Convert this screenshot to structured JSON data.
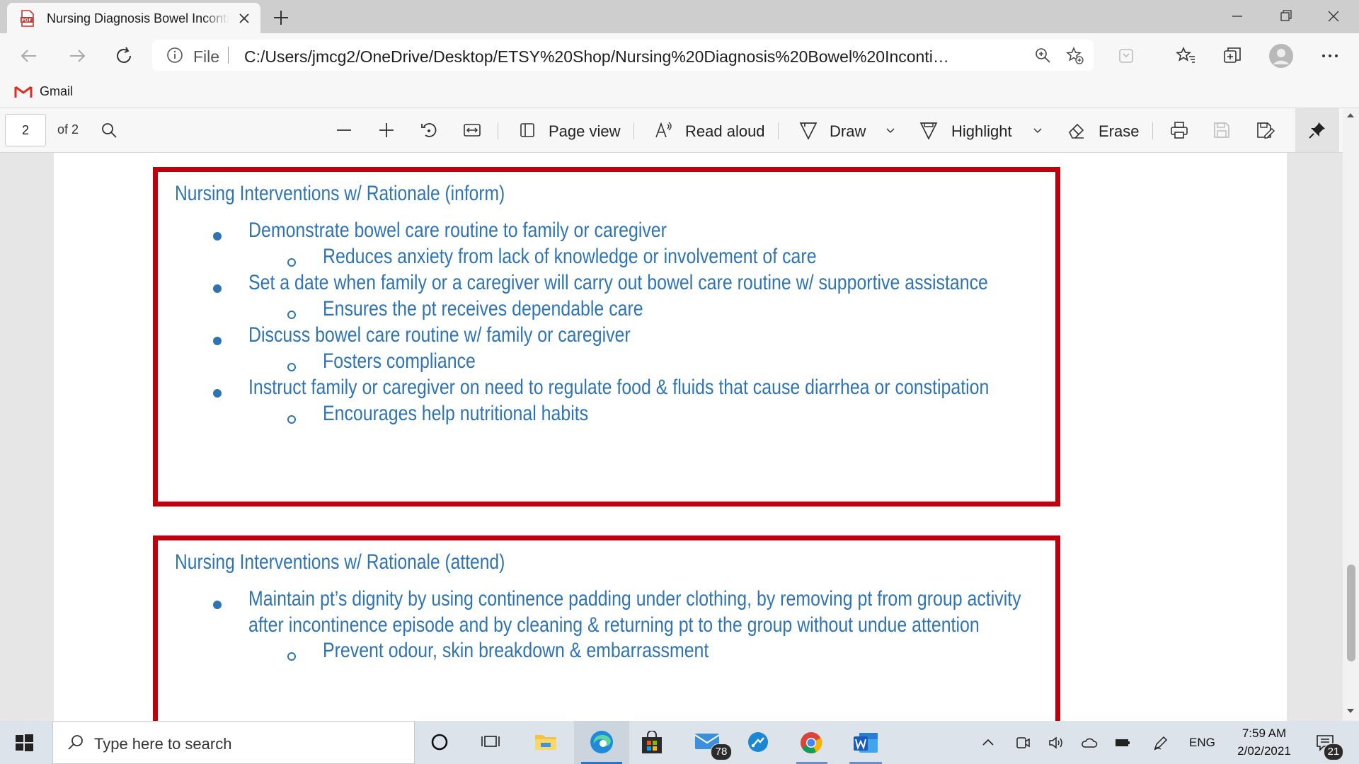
{
  "tab": {
    "title": "Nursing Diagnosis Bowel Incontinence"
  },
  "address": {
    "scheme_label": "File",
    "url": "C:/Users/jmcg2/OneDrive/Desktop/ETSY%20Shop/Nursing%20Diagnosis%20Bowel%20Incontinence..."
  },
  "bookmarks": [
    {
      "label": "Gmail"
    }
  ],
  "pdf_toolbar": {
    "page_number": "2",
    "page_count": "of 2",
    "page_view_label": "Page view",
    "read_aloud_label": "Read aloud",
    "draw_label": "Draw",
    "highlight_label": "Highlight",
    "erase_label": "Erase"
  },
  "document": {
    "sections": [
      {
        "title": "Nursing Interventions w/ Rationale (inform)",
        "items": [
          {
            "text": "Demonstrate bowel care routine to family or caregiver",
            "rationale": "Reduces anxiety from lack of knowledge or involvement of care"
          },
          {
            "text": "Set a date when family or a caregiver will carry out bowel care routine w/ supportive assistance",
            "rationale": "Ensures the pt receives dependable care"
          },
          {
            "text": "Discuss bowel care routine w/ family or caregiver",
            "rationale": "Fosters compliance"
          },
          {
            "text": "Instruct family or caregiver on need to regulate food & fluids that cause diarrhea or constipation",
            "rationale": "Encourages help nutritional habits"
          }
        ]
      },
      {
        "title": "Nursing Interventions w/ Rationale (attend)",
        "items": [
          {
            "text_line1": "Maintain pt’s dignity by using continence padding under clothing, by removing pt from group activity",
            "text_line2": "after incontinence episode and by cleaning & returning pt to the group without undue attention",
            "rationale": "Prevent odour, skin breakdown & embarrassment"
          }
        ]
      }
    ]
  },
  "taskbar": {
    "search_placeholder": "Type here to search",
    "mail_badge": "78",
    "language": "ENG",
    "time": "7:59 AM",
    "date": "2/02/2021",
    "notification_count": "21"
  },
  "colors": {
    "doc_text": "#2e74b5",
    "box_border": "#c0000c",
    "accent": "#2277cc"
  }
}
